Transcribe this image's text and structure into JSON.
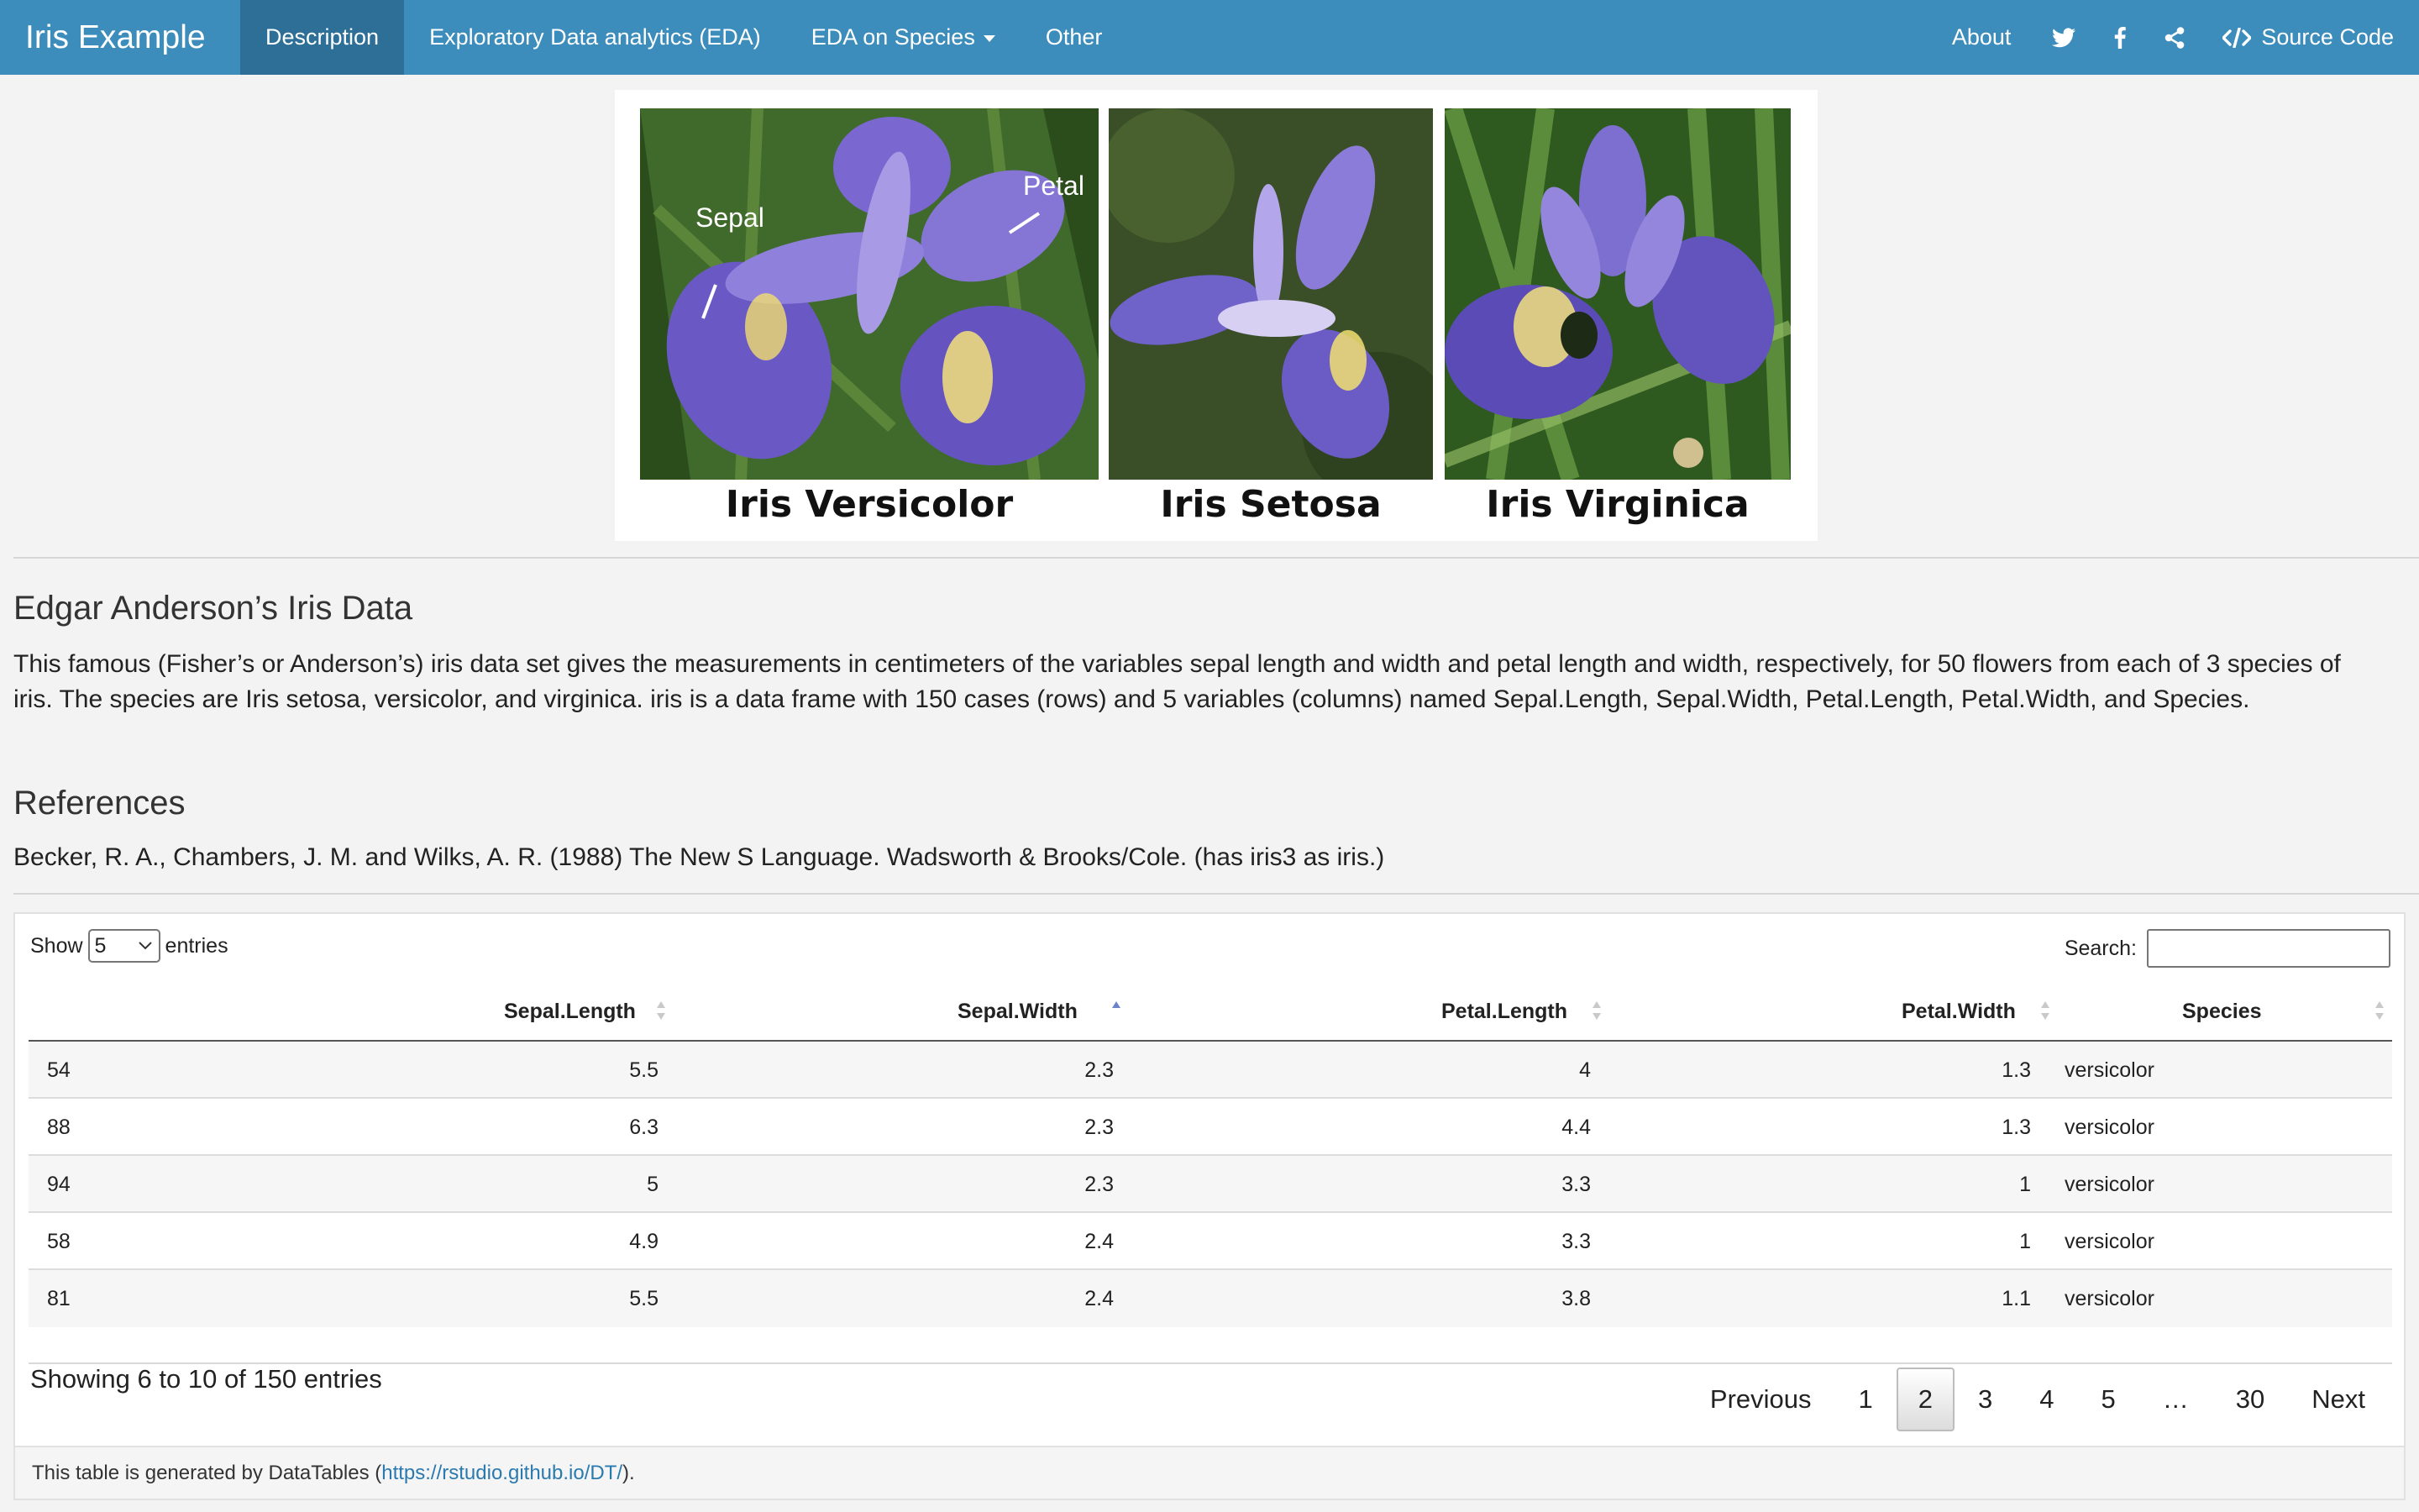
{
  "navbar": {
    "brand": "Iris Example",
    "tabs": [
      {
        "label": "Description",
        "active": true
      },
      {
        "label": "Exploratory Data analytics (EDA)"
      },
      {
        "label": "EDA on Species",
        "dropdown": true
      },
      {
        "label": "Other"
      }
    ],
    "about_label": "About",
    "icons": [
      "twitter-icon",
      "facebook-icon",
      "share-icon",
      "code-icon"
    ],
    "source_code_label": "Source Code",
    "color": "#3c8dbc",
    "active_color": "#2d6f97"
  },
  "flowers": {
    "items": [
      {
        "caption": "Iris Versicolor"
      },
      {
        "caption": "Iris Setosa"
      },
      {
        "caption": "Iris Virginica"
      }
    ],
    "annotations": {
      "sepal": "Sepal",
      "petal": "Petal"
    }
  },
  "about": {
    "title": "Edgar Anderson’s Iris Data",
    "description": "This famous (Fisher’s or Anderson’s) iris data set gives the measurements in centimeters of the variables sepal length and width and petal length and width, respectively, for 50 flowers from each of 3 species of iris. The species are Iris setosa, versicolor, and virginica. iris is a data frame with 150 cases (rows) and 5 variables (columns) named Sepal.Length, Sepal.Width, Petal.Length, Petal.Width, and Species.",
    "references_title": "References",
    "reference": "Becker, R. A., Chambers, J. M. and Wilks, A. R. (1988) The New S Language. Wadsworth & Brooks/Cole. (has iris3 as iris.)"
  },
  "table": {
    "show_label": "Show",
    "entries_label": "entries",
    "page_size": "5",
    "search_label": "Search:",
    "search_value": "",
    "columns": [
      "",
      "Sepal.Length",
      "Sepal.Width",
      "Petal.Length",
      "Petal.Width",
      "Species"
    ],
    "sorted_column": "Sepal.Width",
    "sort_direction": "ascending",
    "rows": [
      [
        "54",
        "5.5",
        "2.3",
        "4",
        "1.3",
        "versicolor"
      ],
      [
        "88",
        "6.3",
        "2.3",
        "4.4",
        "1.3",
        "versicolor"
      ],
      [
        "94",
        "5",
        "2.3",
        "3.3",
        "1",
        "versicolor"
      ],
      [
        "58",
        "4.9",
        "2.4",
        "3.3",
        "1",
        "versicolor"
      ],
      [
        "81",
        "5.5",
        "2.4",
        "3.8",
        "1.1",
        "versicolor"
      ]
    ],
    "info": "Showing 6 to 10 of 150 entries",
    "pagination": {
      "previous": "Previous",
      "pages": [
        "1",
        "2",
        "3",
        "4",
        "5",
        "…",
        "30"
      ],
      "current": "2",
      "next": "Next"
    },
    "footer_prefix": "This table is generated by DataTables (",
    "footer_link": "https://rstudio.github.io/DT/",
    "footer_suffix": ")."
  }
}
